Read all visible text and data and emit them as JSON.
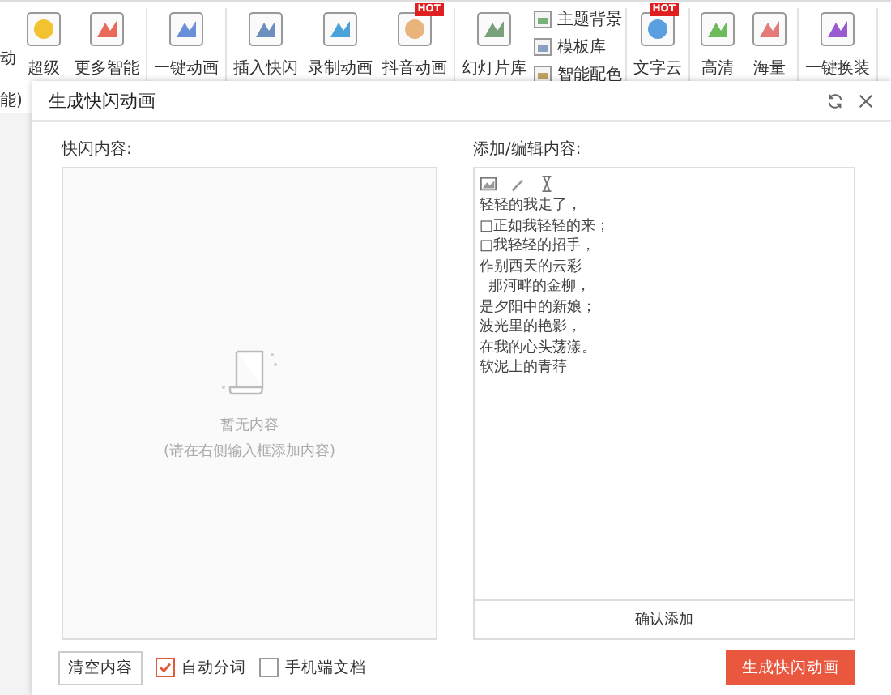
{
  "ribbon": {
    "groups": [
      {
        "items": [
          {
            "label": "超级"
          },
          {
            "label": "更多智能"
          }
        ]
      },
      {
        "items": [
          {
            "label": "一键动画"
          }
        ]
      },
      {
        "items": [
          {
            "label": "插入快闪"
          },
          {
            "label": "录制动画"
          },
          {
            "label": "抖音动画",
            "badge": "HOT"
          }
        ]
      },
      {
        "items": [
          {
            "label": "幻灯片库"
          }
        ],
        "small": [
          {
            "label": "主题背景"
          },
          {
            "label": "模板库"
          },
          {
            "label": "智能配色"
          }
        ]
      },
      {
        "items": [
          {
            "label": "文字云",
            "badge": "HOT"
          }
        ]
      },
      {
        "items": [
          {
            "label": "高清"
          },
          {
            "label": "海量"
          }
        ]
      },
      {
        "items": [
          {
            "label": "一键换装"
          }
        ]
      }
    ],
    "left_fragments": [
      "动",
      "能)"
    ]
  },
  "dialog": {
    "title": "生成快闪动画",
    "left_panel": {
      "label": "快闪内容:",
      "empty_title": "暂无内容",
      "empty_hint": "(请在右侧输入框添加内容)"
    },
    "right_panel": {
      "label": "添加/编辑内容:",
      "lines": [
        "轻轻的我走了，",
        "□正如我轻轻的来；",
        "□我轻轻的招手，",
        "作别西天的云彩",
        "  那河畔的金柳，",
        "是夕阳中的新娘；",
        "波光里的艳影，",
        "在我的心头荡漾。",
        "软泥上的青荇"
      ],
      "confirm_button": "确认添加"
    },
    "clear_button": "清空内容",
    "options": [
      {
        "label": "自动分词",
        "checked": true
      },
      {
        "label": "手机端文档",
        "checked": false
      }
    ],
    "generate_button": "生成快闪动画"
  }
}
